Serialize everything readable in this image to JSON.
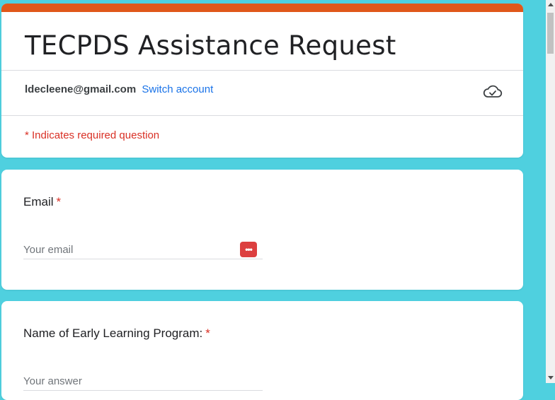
{
  "colors": {
    "page_background": "#4fd0df",
    "accent_bar": "#e0581a",
    "link": "#1a73e8",
    "required": "#d93025"
  },
  "header": {
    "title": "TECPDS Assistance Request",
    "account_email": "ldecleene@gmail.com",
    "switch_account_label": "Switch account",
    "cloud_icon": "cloud-check-icon",
    "required_note": "* Indicates required question"
  },
  "questions": [
    {
      "label": "Email",
      "required_mark": "*",
      "placeholder": "Your email",
      "icon": "password-manager-icon"
    },
    {
      "label": "Name of Early Learning Program:",
      "required_mark": "*",
      "placeholder": "Your answer"
    }
  ]
}
